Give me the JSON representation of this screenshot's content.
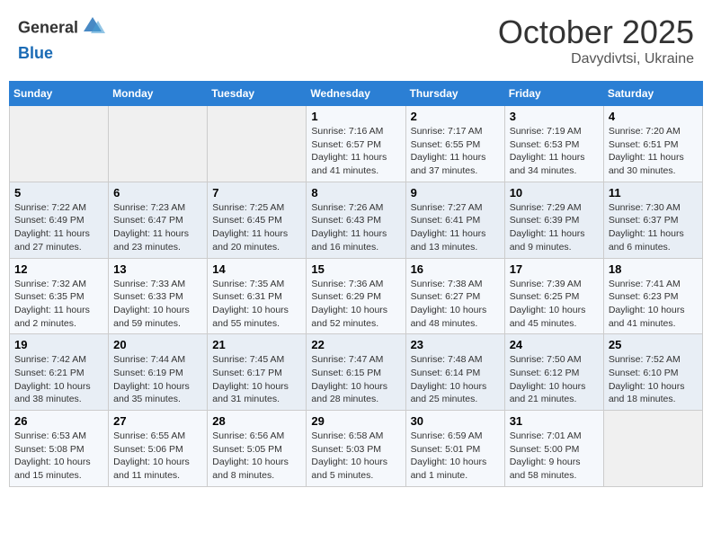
{
  "header": {
    "logo_line1": "General",
    "logo_line2": "Blue",
    "month_title": "October 2025",
    "location": "Davydivtsi, Ukraine"
  },
  "weekdays": [
    "Sunday",
    "Monday",
    "Tuesday",
    "Wednesday",
    "Thursday",
    "Friday",
    "Saturday"
  ],
  "weeks": [
    [
      {
        "day": "",
        "sunrise": "",
        "sunset": "",
        "daylight": ""
      },
      {
        "day": "",
        "sunrise": "",
        "sunset": "",
        "daylight": ""
      },
      {
        "day": "",
        "sunrise": "",
        "sunset": "",
        "daylight": ""
      },
      {
        "day": "1",
        "sunrise": "Sunrise: 7:16 AM",
        "sunset": "Sunset: 6:57 PM",
        "daylight": "Daylight: 11 hours and 41 minutes."
      },
      {
        "day": "2",
        "sunrise": "Sunrise: 7:17 AM",
        "sunset": "Sunset: 6:55 PM",
        "daylight": "Daylight: 11 hours and 37 minutes."
      },
      {
        "day": "3",
        "sunrise": "Sunrise: 7:19 AM",
        "sunset": "Sunset: 6:53 PM",
        "daylight": "Daylight: 11 hours and 34 minutes."
      },
      {
        "day": "4",
        "sunrise": "Sunrise: 7:20 AM",
        "sunset": "Sunset: 6:51 PM",
        "daylight": "Daylight: 11 hours and 30 minutes."
      }
    ],
    [
      {
        "day": "5",
        "sunrise": "Sunrise: 7:22 AM",
        "sunset": "Sunset: 6:49 PM",
        "daylight": "Daylight: 11 hours and 27 minutes."
      },
      {
        "day": "6",
        "sunrise": "Sunrise: 7:23 AM",
        "sunset": "Sunset: 6:47 PM",
        "daylight": "Daylight: 11 hours and 23 minutes."
      },
      {
        "day": "7",
        "sunrise": "Sunrise: 7:25 AM",
        "sunset": "Sunset: 6:45 PM",
        "daylight": "Daylight: 11 hours and 20 minutes."
      },
      {
        "day": "8",
        "sunrise": "Sunrise: 7:26 AM",
        "sunset": "Sunset: 6:43 PM",
        "daylight": "Daylight: 11 hours and 16 minutes."
      },
      {
        "day": "9",
        "sunrise": "Sunrise: 7:27 AM",
        "sunset": "Sunset: 6:41 PM",
        "daylight": "Daylight: 11 hours and 13 minutes."
      },
      {
        "day": "10",
        "sunrise": "Sunrise: 7:29 AM",
        "sunset": "Sunset: 6:39 PM",
        "daylight": "Daylight: 11 hours and 9 minutes."
      },
      {
        "day": "11",
        "sunrise": "Sunrise: 7:30 AM",
        "sunset": "Sunset: 6:37 PM",
        "daylight": "Daylight: 11 hours and 6 minutes."
      }
    ],
    [
      {
        "day": "12",
        "sunrise": "Sunrise: 7:32 AM",
        "sunset": "Sunset: 6:35 PM",
        "daylight": "Daylight: 11 hours and 2 minutes."
      },
      {
        "day": "13",
        "sunrise": "Sunrise: 7:33 AM",
        "sunset": "Sunset: 6:33 PM",
        "daylight": "Daylight: 10 hours and 59 minutes."
      },
      {
        "day": "14",
        "sunrise": "Sunrise: 7:35 AM",
        "sunset": "Sunset: 6:31 PM",
        "daylight": "Daylight: 10 hours and 55 minutes."
      },
      {
        "day": "15",
        "sunrise": "Sunrise: 7:36 AM",
        "sunset": "Sunset: 6:29 PM",
        "daylight": "Daylight: 10 hours and 52 minutes."
      },
      {
        "day": "16",
        "sunrise": "Sunrise: 7:38 AM",
        "sunset": "Sunset: 6:27 PM",
        "daylight": "Daylight: 10 hours and 48 minutes."
      },
      {
        "day": "17",
        "sunrise": "Sunrise: 7:39 AM",
        "sunset": "Sunset: 6:25 PM",
        "daylight": "Daylight: 10 hours and 45 minutes."
      },
      {
        "day": "18",
        "sunrise": "Sunrise: 7:41 AM",
        "sunset": "Sunset: 6:23 PM",
        "daylight": "Daylight: 10 hours and 41 minutes."
      }
    ],
    [
      {
        "day": "19",
        "sunrise": "Sunrise: 7:42 AM",
        "sunset": "Sunset: 6:21 PM",
        "daylight": "Daylight: 10 hours and 38 minutes."
      },
      {
        "day": "20",
        "sunrise": "Sunrise: 7:44 AM",
        "sunset": "Sunset: 6:19 PM",
        "daylight": "Daylight: 10 hours and 35 minutes."
      },
      {
        "day": "21",
        "sunrise": "Sunrise: 7:45 AM",
        "sunset": "Sunset: 6:17 PM",
        "daylight": "Daylight: 10 hours and 31 minutes."
      },
      {
        "day": "22",
        "sunrise": "Sunrise: 7:47 AM",
        "sunset": "Sunset: 6:15 PM",
        "daylight": "Daylight: 10 hours and 28 minutes."
      },
      {
        "day": "23",
        "sunrise": "Sunrise: 7:48 AM",
        "sunset": "Sunset: 6:14 PM",
        "daylight": "Daylight: 10 hours and 25 minutes."
      },
      {
        "day": "24",
        "sunrise": "Sunrise: 7:50 AM",
        "sunset": "Sunset: 6:12 PM",
        "daylight": "Daylight: 10 hours and 21 minutes."
      },
      {
        "day": "25",
        "sunrise": "Sunrise: 7:52 AM",
        "sunset": "Sunset: 6:10 PM",
        "daylight": "Daylight: 10 hours and 18 minutes."
      }
    ],
    [
      {
        "day": "26",
        "sunrise": "Sunrise: 6:53 AM",
        "sunset": "Sunset: 5:08 PM",
        "daylight": "Daylight: 10 hours and 15 minutes."
      },
      {
        "day": "27",
        "sunrise": "Sunrise: 6:55 AM",
        "sunset": "Sunset: 5:06 PM",
        "daylight": "Daylight: 10 hours and 11 minutes."
      },
      {
        "day": "28",
        "sunrise": "Sunrise: 6:56 AM",
        "sunset": "Sunset: 5:05 PM",
        "daylight": "Daylight: 10 hours and 8 minutes."
      },
      {
        "day": "29",
        "sunrise": "Sunrise: 6:58 AM",
        "sunset": "Sunset: 5:03 PM",
        "daylight": "Daylight: 10 hours and 5 minutes."
      },
      {
        "day": "30",
        "sunrise": "Sunrise: 6:59 AM",
        "sunset": "Sunset: 5:01 PM",
        "daylight": "Daylight: 10 hours and 1 minute."
      },
      {
        "day": "31",
        "sunrise": "Sunrise: 7:01 AM",
        "sunset": "Sunset: 5:00 PM",
        "daylight": "Daylight: 9 hours and 58 minutes."
      },
      {
        "day": "",
        "sunrise": "",
        "sunset": "",
        "daylight": ""
      }
    ]
  ]
}
